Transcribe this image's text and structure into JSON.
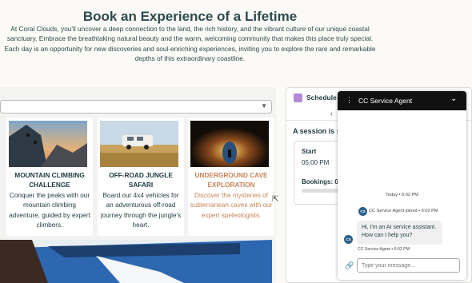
{
  "hero": {
    "title": "Book an Experience of a Lifetime",
    "description": "At Coral Clouds, you'll uncover a deep connection to the land, the rich history, and the vibrant culture of our unique coastal sanctuary. Embrace the breathtaking natural beauty and the warm, welcoming community that makes this place truly special. Each day is an opportunity for new discoveries and soul-enriching experiences, inviting you to explore the rare and remarkable depths of this extraordinary coastline."
  },
  "experiences": [
    {
      "title": "MOUNTAIN CLIMBING CHALLENGE",
      "description": "Conquer the peaks with our mountain climbing adventure, guided by expert climbers.",
      "image_icon": "mountain-climber-image"
    },
    {
      "title": "OFF-ROAD JUNGLE SAFARI",
      "description": "Board our 4x4 vehicles for an adventurous off-road journey through the jungle's heart.",
      "image_icon": "safari-truck-image"
    },
    {
      "title": "UNDERGROUND CAVE EXPLORATION",
      "description": "Discover the mysteries of subterranean caves with our expert speleologists.",
      "image_icon": "cave-image"
    }
  ],
  "schedule": {
    "title": "Schedule",
    "nav_icon": "chevron-left-icon",
    "session_text": "A session is s",
    "start_label": "Start",
    "start_time": "05:00 PM",
    "bookings_label": "Bookings: 0,"
  },
  "chat": {
    "title": "CC Service Agent",
    "day_label": "Today • 6:02 PM",
    "avatar_initials": "CS",
    "joined_text": "CC Service Agent joined • 6:02 PM",
    "message": "Hi, I'm an AI service assistant. How can I help you?",
    "message_meta": "CC Service Agent • 6:02 PM",
    "input_placeholder": "Type your message..."
  },
  "colors": {
    "accent_highlight": "#c68458",
    "heading": "#2d4a4e",
    "chat_header": "#111111",
    "avatar": "#2b5f8a"
  }
}
